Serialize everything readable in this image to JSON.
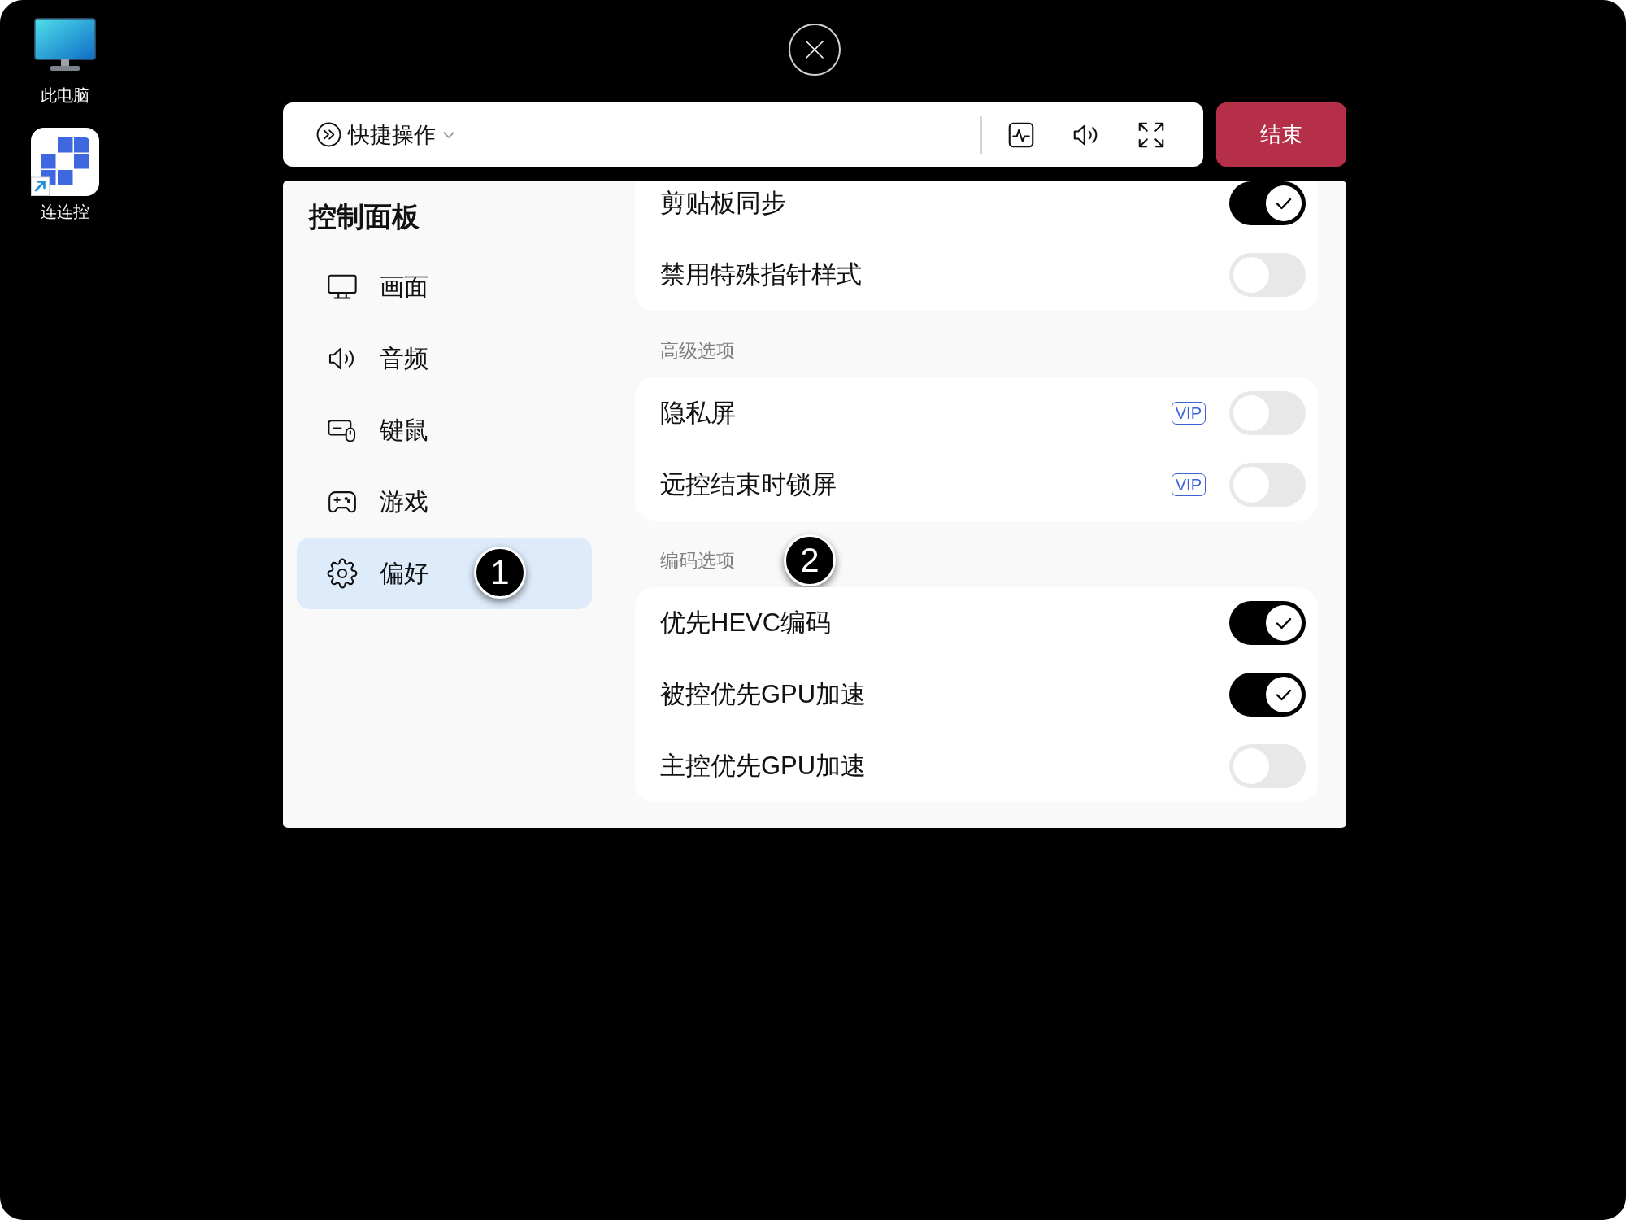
{
  "desktop": {
    "icons": [
      {
        "kind": "computer",
        "label": "此电脑"
      },
      {
        "kind": "shortcut",
        "label": "连连控"
      }
    ]
  },
  "toolbar": {
    "quick_actions": "快捷操作",
    "end_button": "结束"
  },
  "sidebar": {
    "title": "控制面板",
    "items": [
      {
        "kind": "display",
        "label": "画面",
        "selected": false
      },
      {
        "kind": "audio",
        "label": "音频",
        "selected": false
      },
      {
        "kind": "input",
        "label": "键鼠",
        "selected": false
      },
      {
        "kind": "gaming",
        "label": "游戏",
        "selected": false
      },
      {
        "kind": "preferences",
        "label": "偏好",
        "selected": true,
        "callout": "1"
      }
    ]
  },
  "settings": {
    "sections": [
      {
        "rows": [
          {
            "label": "剪贴板同步",
            "on": true
          },
          {
            "label": "禁用特殊指针样式",
            "on": false
          }
        ]
      },
      {
        "heading": "高级选项",
        "rows": [
          {
            "label": "隐私屏",
            "badge": "VIP",
            "on": false
          },
          {
            "label": "远控结束时锁屏",
            "badge": "VIP",
            "on": false
          }
        ]
      },
      {
        "heading": "编码选项",
        "callout": "2",
        "rows": [
          {
            "label": "优先HEVC编码",
            "on": true
          },
          {
            "label": "被控优先GPU加速",
            "on": true
          },
          {
            "label": "主控优先GPU加速",
            "on": false
          }
        ]
      }
    ]
  }
}
